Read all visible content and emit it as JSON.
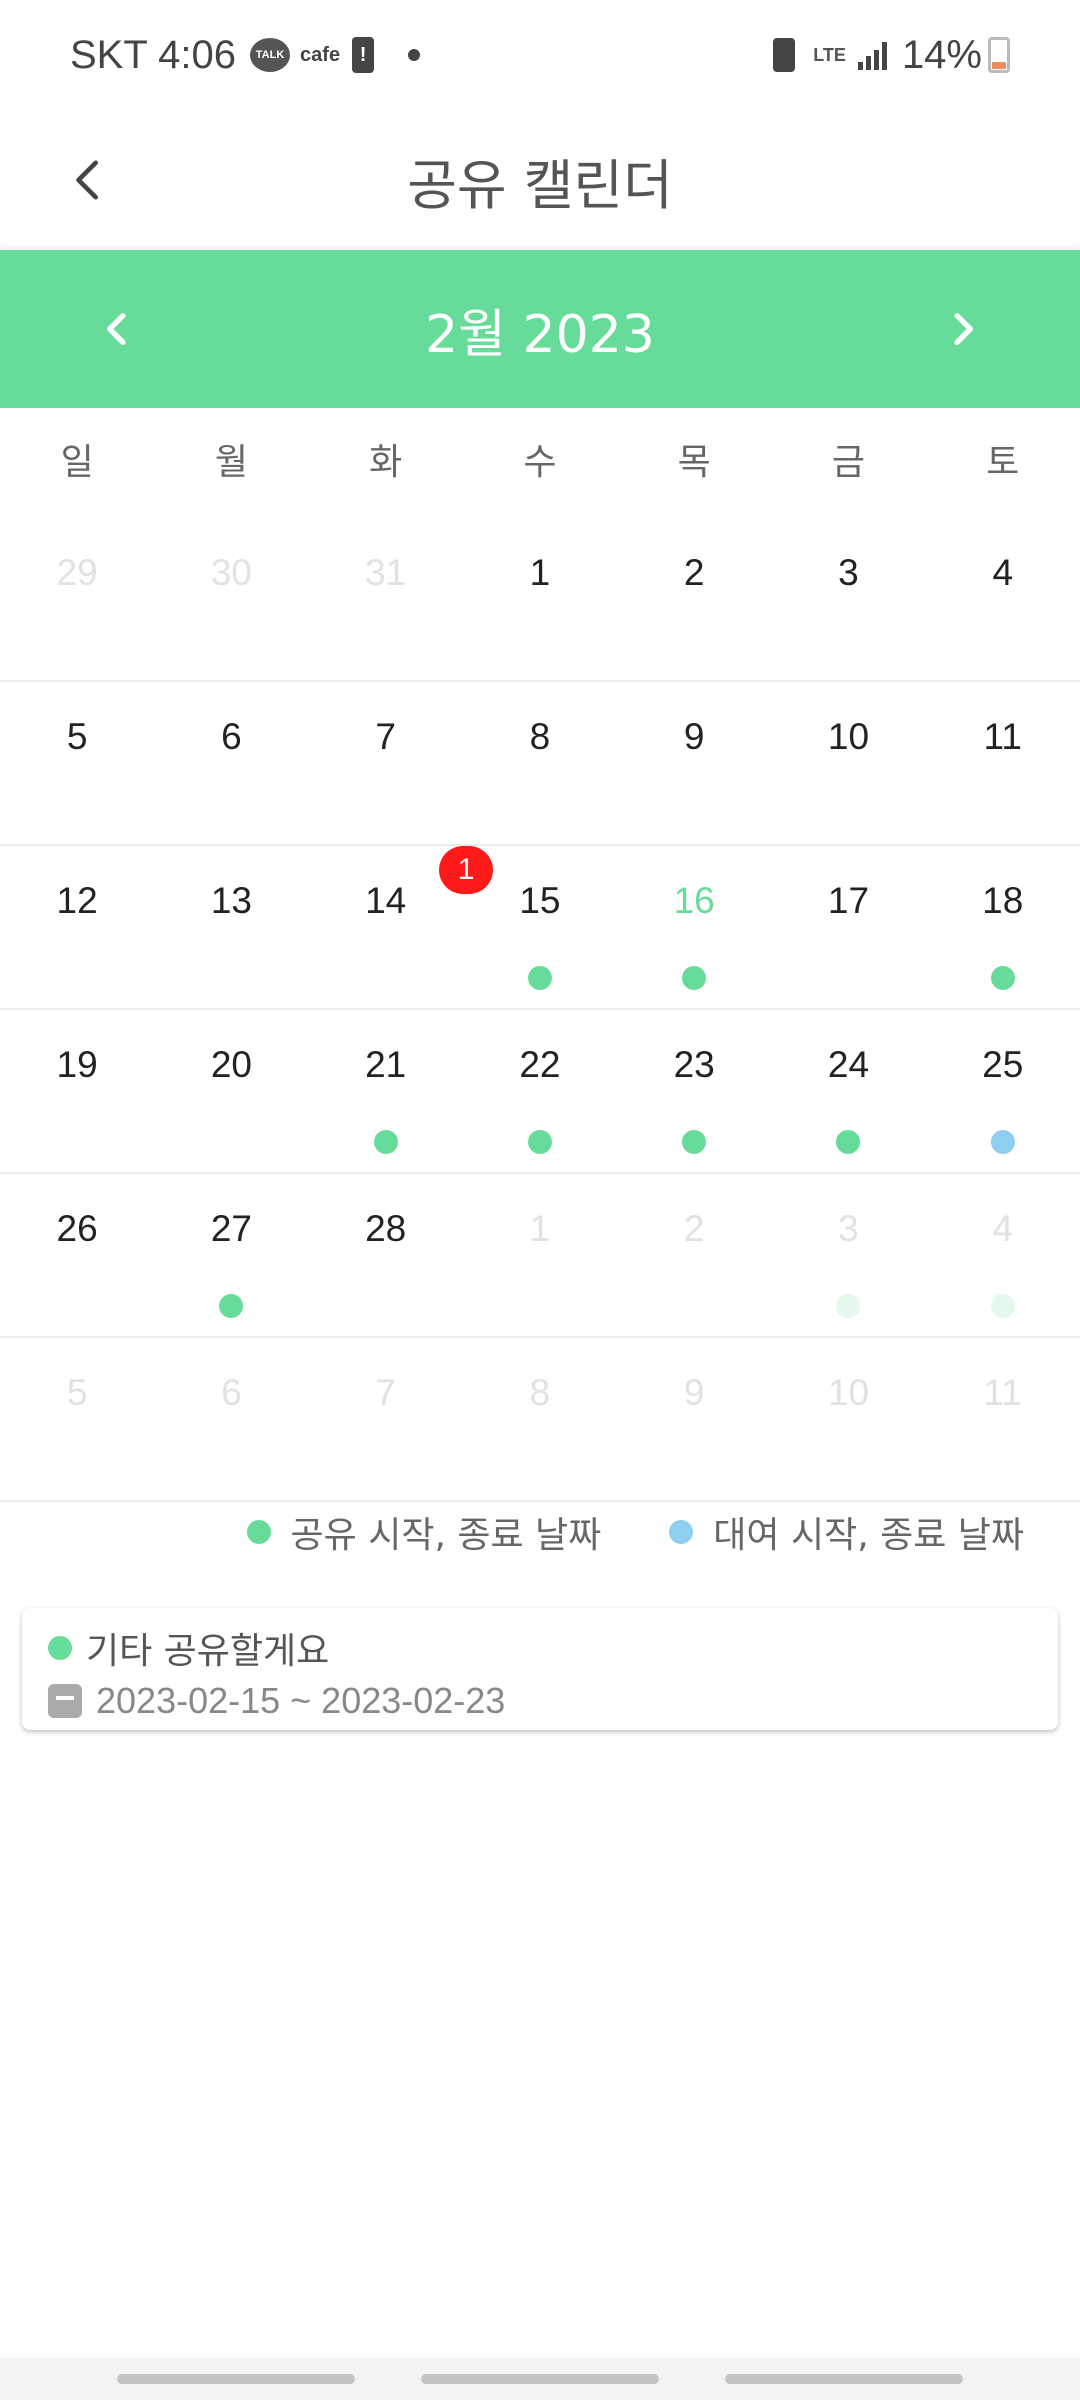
{
  "status_bar": {
    "carrier_time": "SKT 4:06",
    "talk_label": "TALK",
    "cafe_label": "cafe",
    "alert_mark": "!",
    "lte_label": "LTE",
    "battery_percent": "14%"
  },
  "header": {
    "title": "공유 캘린더",
    "back_icon": "chevron-left-icon"
  },
  "month_bar": {
    "title": "2월  2023",
    "prev_icon": "chevron-left-icon",
    "next_icon": "chevron-right-icon",
    "background_color": "#67dc9a"
  },
  "weekdays": [
    "일",
    "월",
    "화",
    "수",
    "목",
    "금",
    "토"
  ],
  "calendar": {
    "weeks": [
      [
        {
          "day": "29",
          "other": true
        },
        {
          "day": "30",
          "other": true
        },
        {
          "day": "31",
          "other": true
        },
        {
          "day": "1"
        },
        {
          "day": "2"
        },
        {
          "day": "3"
        },
        {
          "day": "4"
        }
      ],
      [
        {
          "day": "5"
        },
        {
          "day": "6"
        },
        {
          "day": "7"
        },
        {
          "day": "8"
        },
        {
          "day": "9"
        },
        {
          "day": "10"
        },
        {
          "day": "11"
        }
      ],
      [
        {
          "day": "12"
        },
        {
          "day": "13"
        },
        {
          "day": "14"
        },
        {
          "day": "15",
          "dot": "share",
          "badge": "1"
        },
        {
          "day": "16",
          "dot": "share",
          "today": true
        },
        {
          "day": "17"
        },
        {
          "day": "18",
          "dot": "share"
        }
      ],
      [
        {
          "day": "19"
        },
        {
          "day": "20"
        },
        {
          "day": "21",
          "dot": "share"
        },
        {
          "day": "22",
          "dot": "share"
        },
        {
          "day": "23",
          "dot": "share"
        },
        {
          "day": "24",
          "dot": "share"
        },
        {
          "day": "25",
          "dot": "rental"
        }
      ],
      [
        {
          "day": "26"
        },
        {
          "day": "27",
          "dot": "share"
        },
        {
          "day": "28"
        },
        {
          "day": "1",
          "other": true
        },
        {
          "day": "2",
          "other": true
        },
        {
          "day": "3",
          "other": true,
          "dot": "faded"
        },
        {
          "day": "4",
          "other": true,
          "dot": "faded"
        }
      ],
      [
        {
          "day": "5",
          "other": true
        },
        {
          "day": "6",
          "other": true
        },
        {
          "day": "7",
          "other": true
        },
        {
          "day": "8",
          "other": true
        },
        {
          "day": "9",
          "other": true
        },
        {
          "day": "10",
          "other": true
        },
        {
          "day": "11",
          "other": true
        }
      ]
    ],
    "dot_colors": {
      "share": "#67dc9a",
      "rental": "#8ecff0",
      "faded": "#e4f8ec"
    }
  },
  "legend": {
    "share_label": "공유 시작, 종료 날짜",
    "rental_label": "대여 시작, 종료 날짜",
    "share_color": "#67dc9a",
    "rental_color": "#8ecff0"
  },
  "event": {
    "title": "기타 공유할게요",
    "date_range": "2023-02-15 ~ 2023-02-23",
    "dot_color": "#67dc9a",
    "date_icon": "calendar-icon"
  }
}
